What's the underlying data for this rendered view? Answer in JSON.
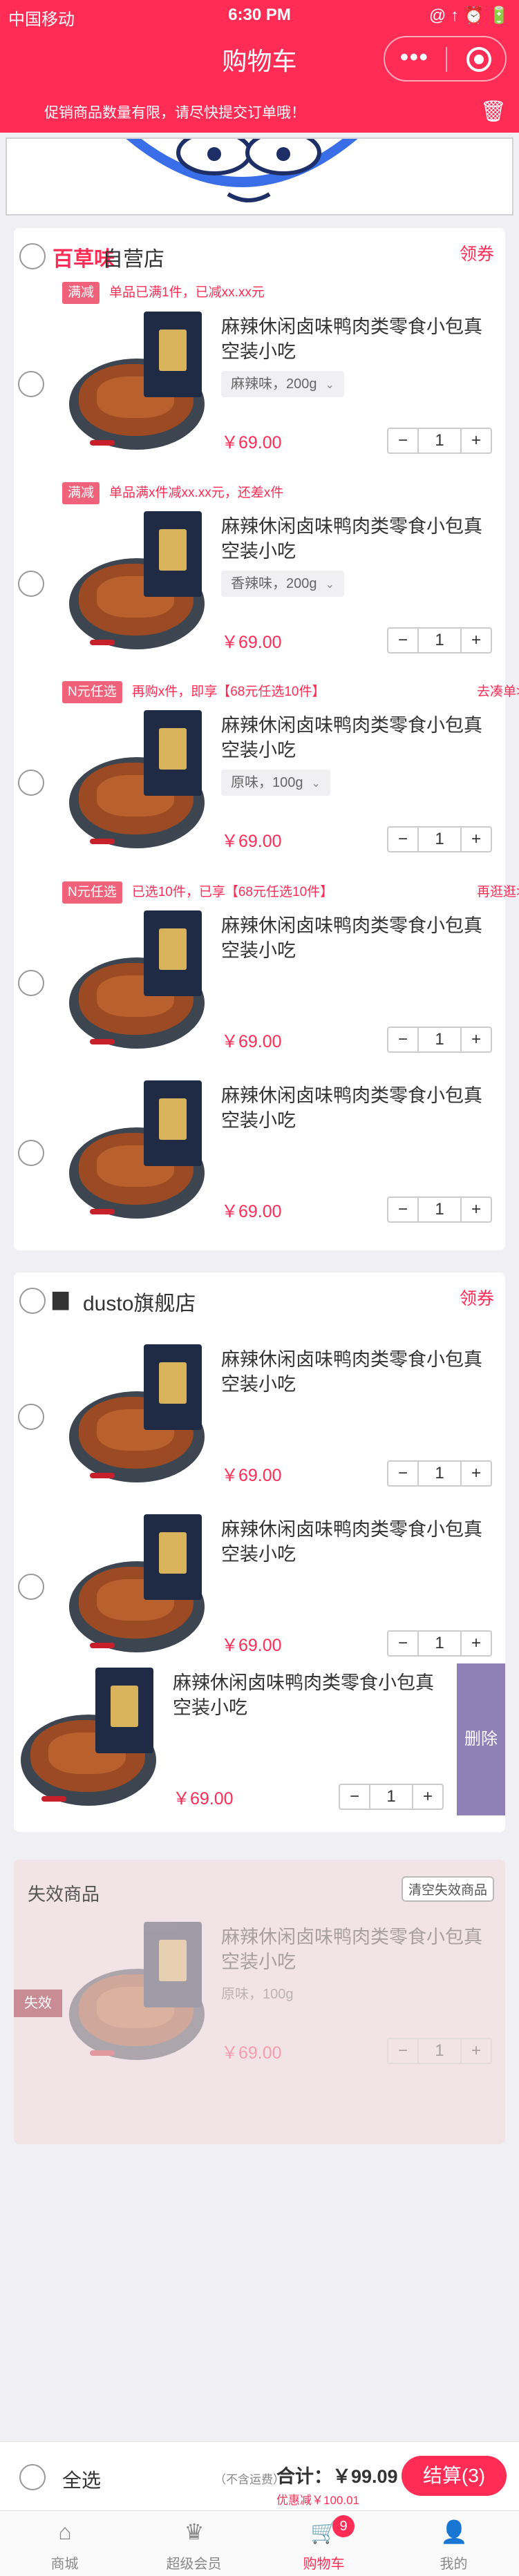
{
  "status_bar": {
    "carrier": "中国移动",
    "time": "6:30 PM",
    "icons": "@ ↑ ⏰ 🔋"
  },
  "nav": {
    "title": "购物车",
    "more_icon": "•••"
  },
  "notice": {
    "text": "促销商品数量有限，请尽快提交订单哦！"
  },
  "product": {
    "name": "麻辣休闲卤味鸭肉类零食小包真空装小吃"
  },
  "shops": [
    {
      "logo": "百草味",
      "name": "自营店",
      "coupon": "领券",
      "promos": [
        {
          "tag": "满减",
          "text": "单品已满1件，已减xx.xx元",
          "action": ""
        },
        {
          "tag": "满减",
          "text": "单品满x件减xx.xx元，还差x件",
          "action": ""
        },
        {
          "tag": "N元任选",
          "text": "再购x件，即享【68元任选10件】",
          "action": "去凑单>"
        },
        {
          "tag": "N元任选",
          "text": "已选10件，已享【68元任选10件】",
          "action": "再逛逛>"
        }
      ],
      "items": [
        {
          "sku": "麻辣味，200g",
          "price": "￥69.00",
          "qty": "1"
        },
        {
          "sku": "香辣味，200g",
          "price": "￥69.00",
          "qty": "1"
        },
        {
          "sku": "原味，100g",
          "price": "￥69.00",
          "qty": "1"
        },
        {
          "sku": "",
          "price": "￥69.00",
          "qty": "1"
        },
        {
          "sku": "",
          "price": "￥69.00",
          "qty": "1"
        }
      ]
    },
    {
      "logo": "",
      "name": "dusto旗舰店",
      "coupon": "领券",
      "items": [
        {
          "price": "￥69.00",
          "qty": "1"
        },
        {
          "price": "￥69.00",
          "qty": "1"
        },
        {
          "price": "￥69.00",
          "qty": "1",
          "delete": "删除"
        }
      ]
    }
  ],
  "invalid": {
    "title": "失效商品",
    "clear": "清空失效商品",
    "badge": "失效",
    "sku": "原味，100g",
    "price": "￥69.00",
    "qty": "1"
  },
  "footer": {
    "select_all": "全选",
    "fee_note": "（不含运费）",
    "total": "合计：￥99.09",
    "discount": "优惠减￥100.01",
    "checkout": "结算(3)"
  },
  "tabs": [
    {
      "label": "商城",
      "icon": "home-icon"
    },
    {
      "label": "超级会员",
      "icon": "crown-icon"
    },
    {
      "label": "购物车",
      "icon": "cart-icon",
      "badge": "9"
    },
    {
      "label": "我的",
      "icon": "user-icon"
    }
  ]
}
